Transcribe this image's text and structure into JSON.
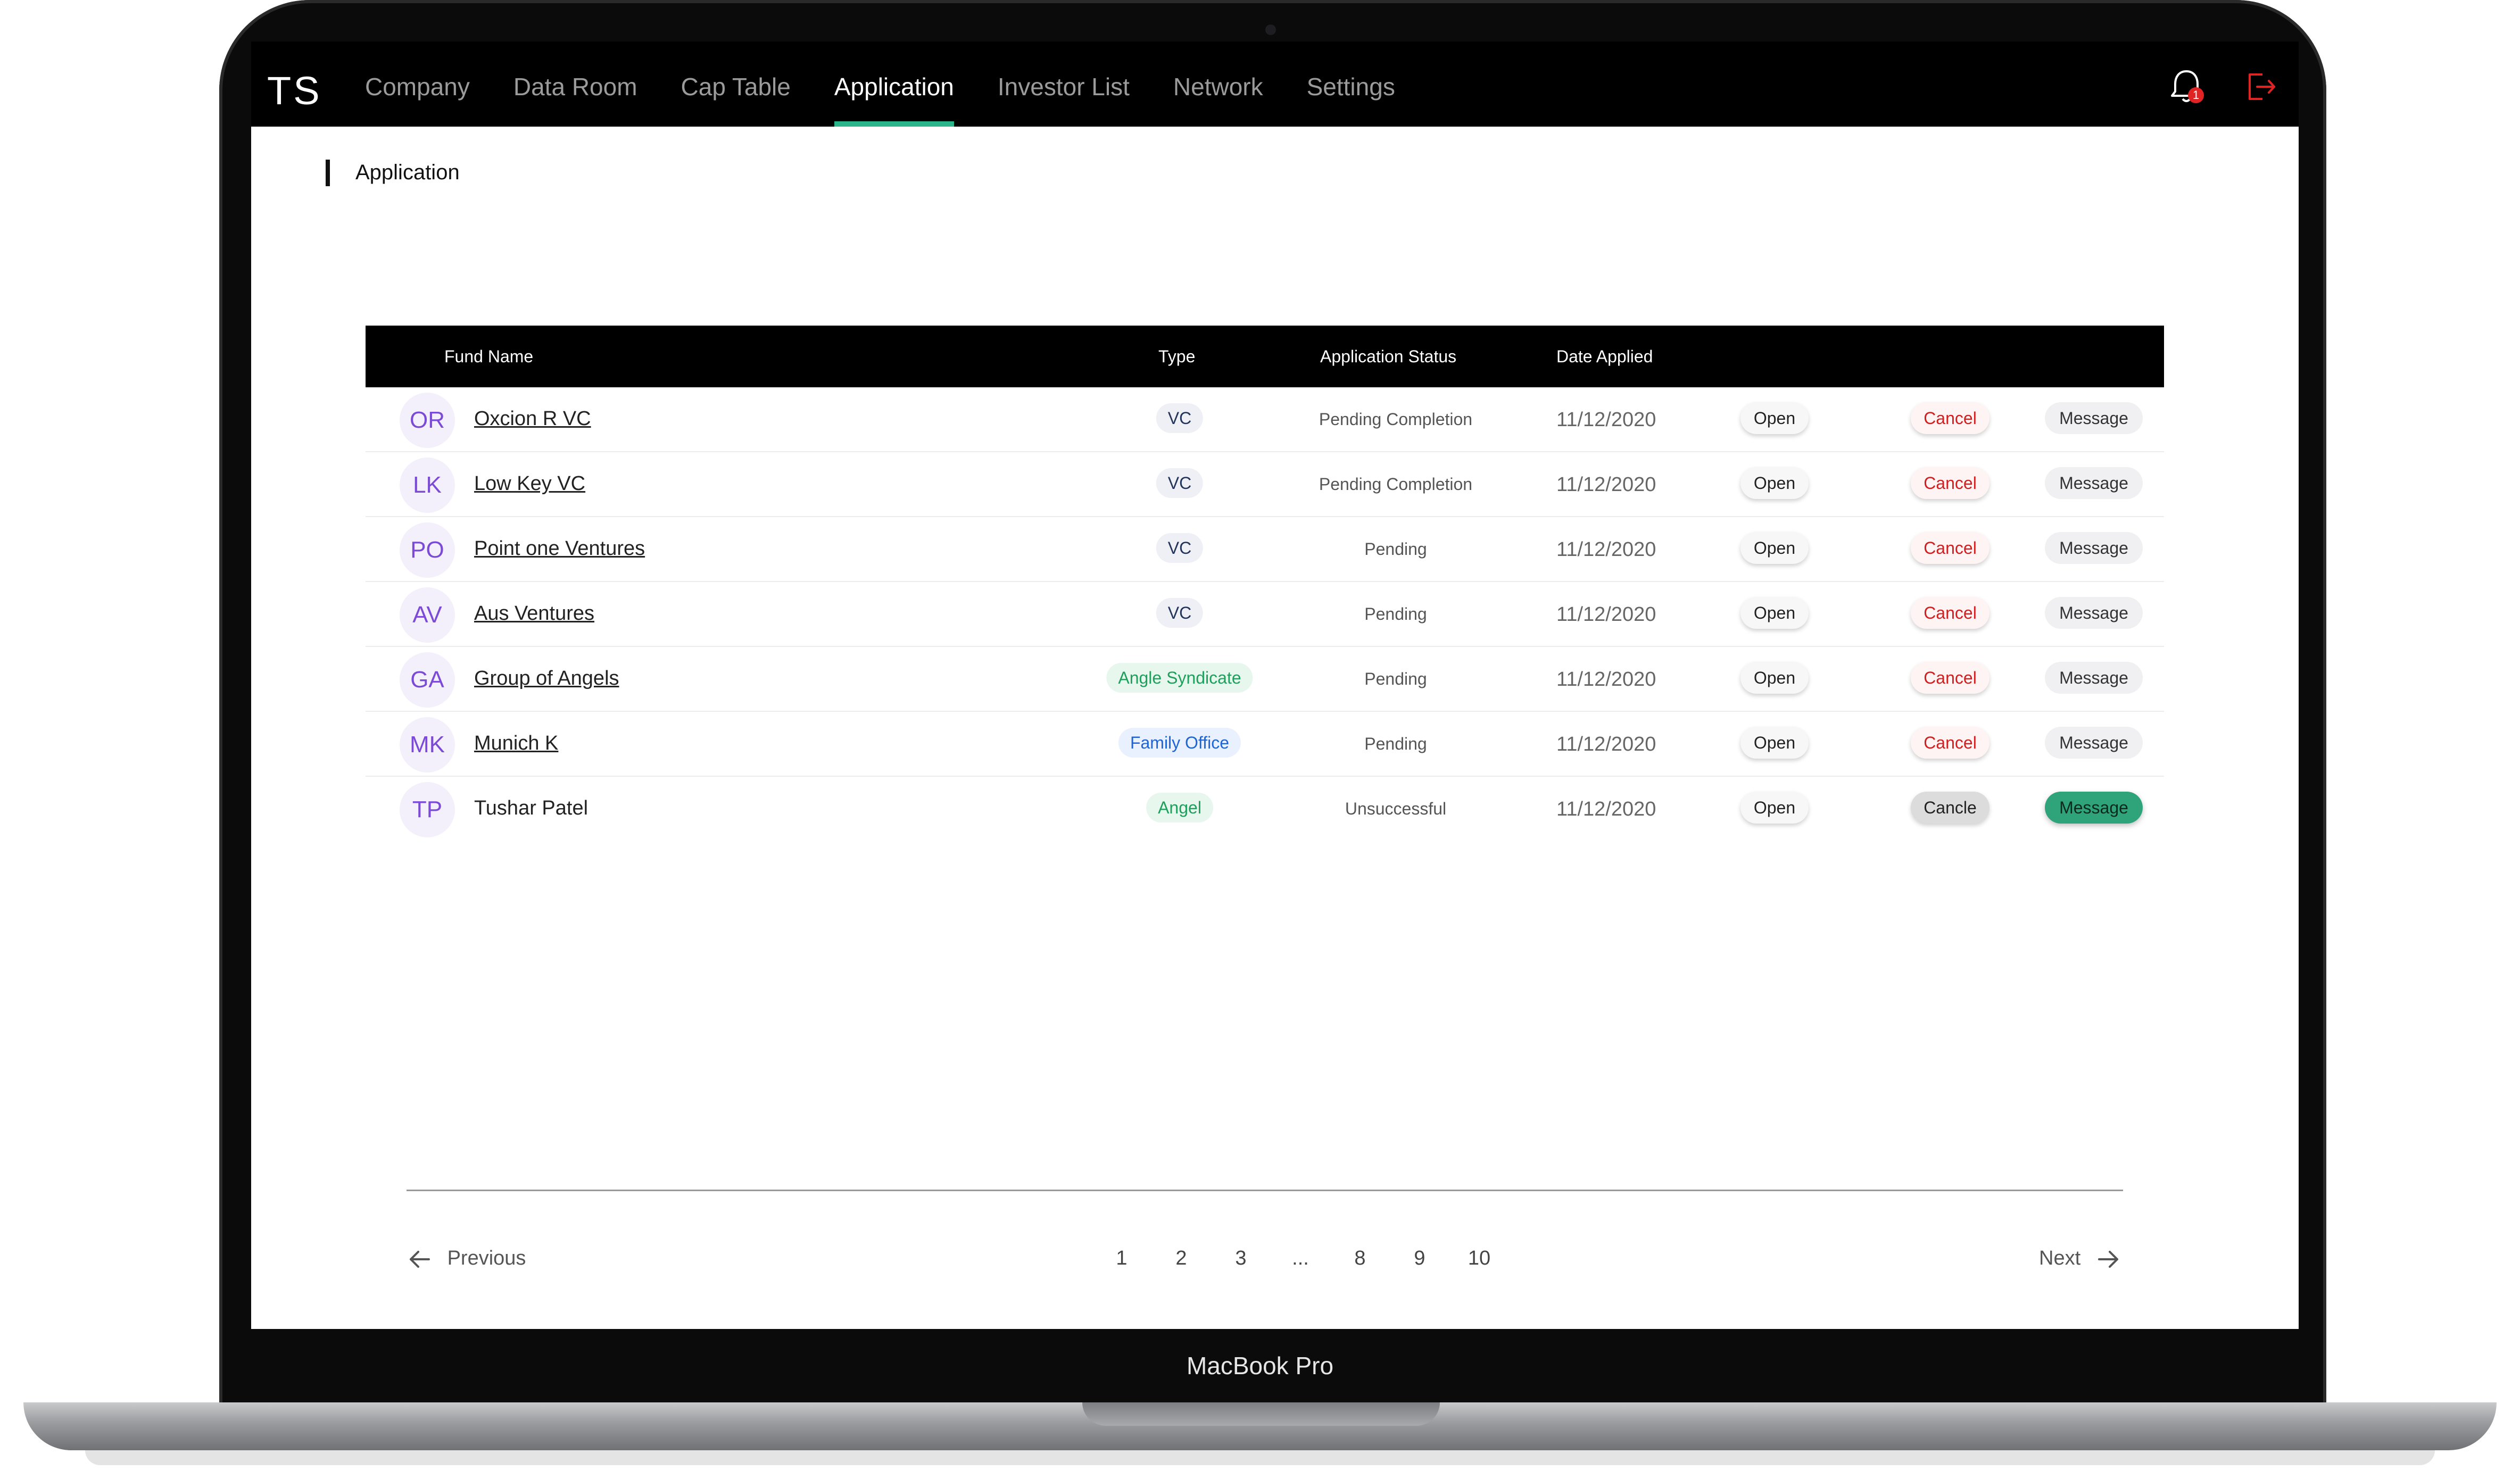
{
  "device": {
    "label": "MacBook Pro"
  },
  "app": {
    "logo": "TS"
  },
  "nav": {
    "items": [
      {
        "label": "Company",
        "active": false
      },
      {
        "label": "Data Room",
        "active": false
      },
      {
        "label": "Cap Table",
        "active": false
      },
      {
        "label": "Application",
        "active": true
      },
      {
        "label": "Investor List",
        "active": false
      },
      {
        "label": "Network",
        "active": false
      },
      {
        "label": "Settings",
        "active": false
      }
    ],
    "notification_count": "1",
    "bell_icon": "bell-icon",
    "logout_icon": "logout-icon"
  },
  "page": {
    "breadcrumb": "Application"
  },
  "table": {
    "headers": {
      "fund_name": "Fund Name",
      "type": "Type",
      "status": "Application Status",
      "date": "Date Applied"
    },
    "rows": [
      {
        "initials": "OR",
        "name": "Oxcion R VC",
        "type": "VC",
        "status": "Pending Completion",
        "date": "11/12/2020",
        "open": "Open",
        "cancel": "Cancel",
        "message": "Message"
      },
      {
        "initials": "LK",
        "name": "Low Key VC",
        "type": "VC",
        "status": "Pending Completion",
        "date": "11/12/2020",
        "open": "Open",
        "cancel": "Cancel",
        "message": "Message"
      },
      {
        "initials": "PO",
        "name": "Point one Ventures",
        "type": "VC",
        "status": "Pending",
        "date": "11/12/2020",
        "open": "Open",
        "cancel": "Cancel",
        "message": "Message"
      },
      {
        "initials": "AV",
        "name": "Aus Ventures",
        "type": "VC",
        "status": "Pending",
        "date": "11/12/2020",
        "open": "Open",
        "cancel": "Cancel",
        "message": "Message"
      },
      {
        "initials": "GA",
        "name": "Group of Angels",
        "type": "Angle Syndicate",
        "status": "Pending",
        "date": "11/12/2020",
        "open": "Open",
        "cancel": "Cancel",
        "message": "Message"
      },
      {
        "initials": "MK",
        "name": "Munich K",
        "type": "Family Office",
        "status": "Pending",
        "date": "11/12/2020",
        "open": "Open",
        "cancel": "Cancel",
        "message": "Message"
      },
      {
        "initials": "TP",
        "name": "Tushar Patel",
        "type": "Angel",
        "status": "Unsuccessful",
        "date": "11/12/2020",
        "open": "Open",
        "cancel": "Cancle",
        "message": "Message"
      }
    ]
  },
  "pagination": {
    "previous": "Previous",
    "next": "Next",
    "pages": [
      "1",
      "2",
      "3",
      "...",
      "8",
      "9",
      "10"
    ]
  },
  "colors": {
    "accent": "#2bb58a",
    "cancel": "#d21e1e",
    "avatar_text": "#7b4ad6",
    "message_active": "#2fa37a"
  }
}
